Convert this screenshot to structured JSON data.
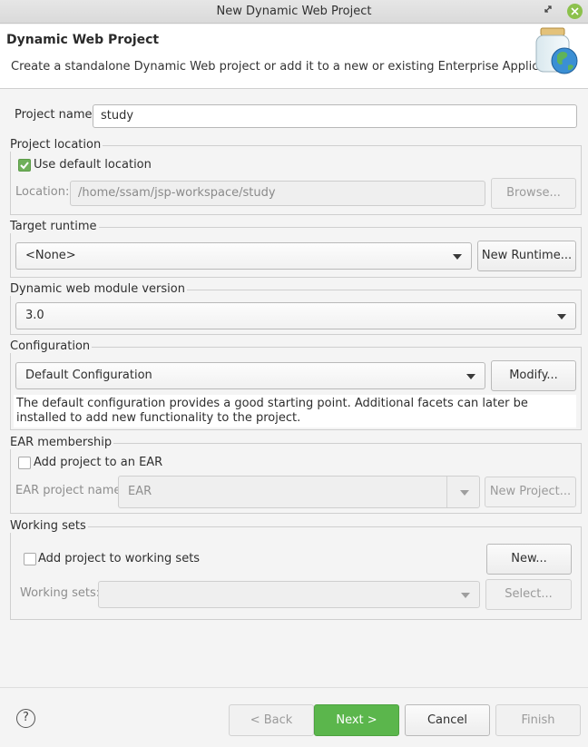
{
  "window": {
    "title": "New Dynamic Web Project"
  },
  "header": {
    "title": "Dynamic Web Project",
    "description": "Create a standalone Dynamic Web project or add it to a new or existing Enterprise Application.",
    "banner_icon": "web-project-jar-globe-icon"
  },
  "project_name": {
    "label": "Project name:",
    "value": "study"
  },
  "project_location": {
    "group_label": "Project location",
    "use_default_label": "Use default location",
    "use_default_checked": true,
    "location_label": "Location:",
    "location_value": "/home/ssam/jsp-workspace/study",
    "browse_label": "Browse..."
  },
  "target_runtime": {
    "group_label": "Target runtime",
    "selected": "<None>",
    "new_runtime_label": "New Runtime..."
  },
  "module_version": {
    "group_label": "Dynamic web module version",
    "selected": "3.0"
  },
  "configuration": {
    "group_label": "Configuration",
    "selected": "Default Configuration",
    "modify_label": "Modify...",
    "description": "The default configuration provides a good starting point. Additional facets can later be installed to add new functionality to the project."
  },
  "ear_membership": {
    "group_label": "EAR membership",
    "add_label": "Add project to an EAR",
    "add_checked": false,
    "ear_name_label": "EAR project name:",
    "ear_name_value": "EAR",
    "new_project_label": "New Project..."
  },
  "working_sets": {
    "group_label": "Working sets",
    "add_label": "Add project to working sets",
    "add_checked": false,
    "new_label": "New...",
    "sets_label": "Working sets:",
    "sets_value": "",
    "select_label": "Select..."
  },
  "footer": {
    "help_symbol": "?",
    "back_label": "< Back",
    "next_label": "Next >",
    "cancel_label": "Cancel",
    "finish_label": "Finish"
  },
  "colors": {
    "primary_button": "#5bb64c",
    "checkbox_checked": "#6fb05a",
    "close_button": "#8cc14c"
  }
}
